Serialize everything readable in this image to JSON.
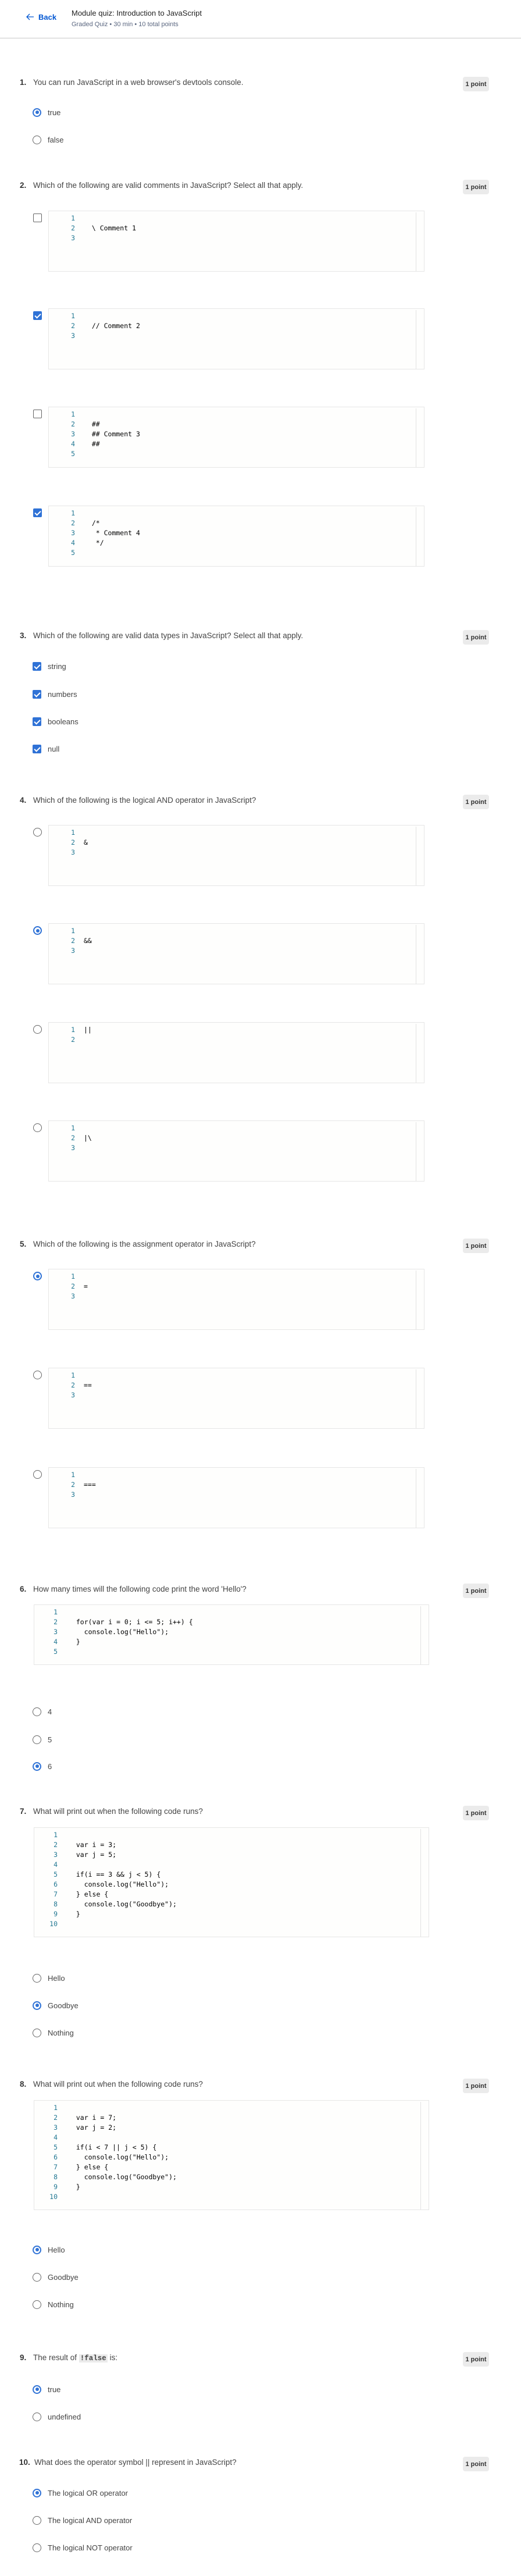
{
  "header": {
    "back_label": "Back",
    "title": "Module quiz: Introduction to JavaScript",
    "subtitle": "Graded Quiz • 30 min • 10 total points"
  },
  "colors": {
    "accent": "#2f72d6",
    "link": "#0056d2",
    "badge_bg": "#ebebeb"
  },
  "questions": [
    {
      "number": "1.",
      "text": "You can run JavaScript in a web browser's devtools console.",
      "points": "1 point",
      "type": "radio",
      "options": [
        {
          "label": "true",
          "selected": true
        },
        {
          "label": "false",
          "selected": false
        }
      ]
    },
    {
      "number": "2.",
      "text": "Which of the following are valid comments in JavaScript? Select all that apply.",
      "points": "1 point",
      "type": "checkbox",
      "options": [
        {
          "code": [
            "",
            "  \\ Comment 1",
            ""
          ],
          "selected": false
        },
        {
          "code": [
            "",
            "  // Comment 2",
            ""
          ],
          "selected": true
        },
        {
          "code": [
            "",
            "  ##",
            "  ## Comment 3",
            "  ##",
            ""
          ],
          "selected": false
        },
        {
          "code": [
            "",
            "  /*",
            "   * Comment 4",
            "   */",
            ""
          ],
          "selected": true
        }
      ]
    },
    {
      "number": "3.",
      "text": "Which of the following are valid data types in JavaScript? Select all that apply.",
      "points": "1 point",
      "type": "checkbox",
      "options": [
        {
          "label": "string",
          "selected": true
        },
        {
          "label": "numbers",
          "selected": true
        },
        {
          "label": "booleans",
          "selected": true
        },
        {
          "label": "null",
          "selected": true
        }
      ]
    },
    {
      "number": "4.",
      "text": "Which of the following is the logical AND operator in JavaScript?",
      "points": "1 point",
      "type": "radio",
      "options": [
        {
          "code": [
            "",
            "&",
            ""
          ],
          "selected": false
        },
        {
          "code": [
            "",
            "&&",
            ""
          ],
          "selected": true
        },
        {
          "code": [
            "||",
            ""
          ],
          "selected": false
        },
        {
          "code": [
            "",
            "|\\",
            ""
          ],
          "selected": false
        }
      ]
    },
    {
      "number": "5.",
      "text": "Which of the following is the assignment operator in JavaScript?",
      "points": "1 point",
      "type": "radio",
      "options": [
        {
          "code": [
            "",
            "=",
            ""
          ],
          "selected": true
        },
        {
          "code": [
            "",
            "==",
            ""
          ],
          "selected": false
        },
        {
          "code": [
            "",
            "===",
            ""
          ],
          "selected": false
        }
      ]
    },
    {
      "number": "6.",
      "text": "How many times will the following code print the word 'Hello'?",
      "points": "1 point",
      "type": "radio",
      "code": [
        "",
        "  for(var i = 0; i <= 5; i++) {",
        "    console.log(\"Hello\");",
        "  }",
        ""
      ],
      "options": [
        {
          "label": "4",
          "selected": false
        },
        {
          "label": "5",
          "selected": false
        },
        {
          "label": "6",
          "selected": true
        }
      ]
    },
    {
      "number": "7.",
      "text": "What will print out when the following code runs?",
      "points": "1 point",
      "type": "radio",
      "code": [
        "",
        "  var i = 3;",
        "  var j = 5;",
        "",
        "  if(i == 3 && j < 5) {",
        "    console.log(\"Hello\");",
        "  } else {",
        "    console.log(\"Goodbye\");",
        "  }",
        ""
      ],
      "options": [
        {
          "label": "Hello",
          "selected": false
        },
        {
          "label": "Goodbye",
          "selected": true
        },
        {
          "label": "Nothing",
          "selected": false
        }
      ]
    },
    {
      "number": "8.",
      "text": "What will print out when the following code runs?",
      "points": "1 point",
      "type": "radio",
      "code": [
        "",
        "  var i = 7;",
        "  var j = 2;",
        "",
        "  if(i < 7 || j < 5) {",
        "    console.log(\"Hello\");",
        "  } else {",
        "    console.log(\"Goodbye\");",
        "  }",
        ""
      ],
      "options": [
        {
          "label": "Hello",
          "selected": true
        },
        {
          "label": "Goodbye",
          "selected": false
        },
        {
          "label": "Nothing",
          "selected": false
        }
      ]
    },
    {
      "number": "9.",
      "text_before": "The result of ",
      "inline_code": "!false",
      "text_after": " is:",
      "points": "1 point",
      "type": "radio",
      "options": [
        {
          "label": "true",
          "selected": true
        },
        {
          "label": "undefined",
          "selected": false
        }
      ]
    },
    {
      "number": "10.",
      "text": "What does the operator symbol || represent in JavaScript?",
      "points": "1 point",
      "type": "radio",
      "options": [
        {
          "label": "The logical OR operator",
          "selected": true
        },
        {
          "label": "The logical AND operator",
          "selected": false
        },
        {
          "label": "The logical NOT operator",
          "selected": false
        }
      ]
    }
  ]
}
